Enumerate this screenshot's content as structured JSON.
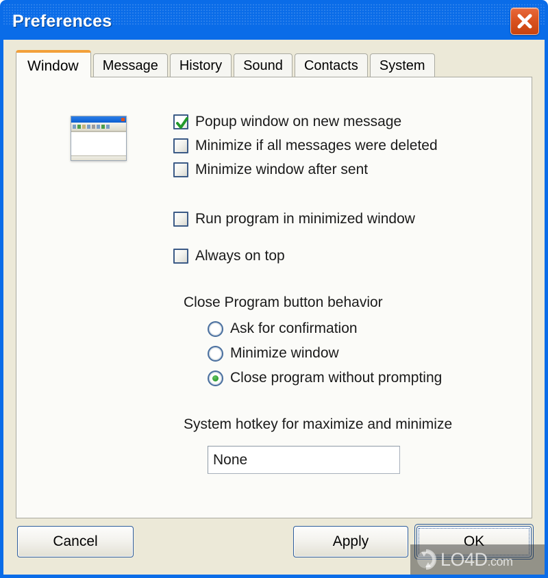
{
  "window": {
    "title": "Preferences",
    "close_icon": "close-x-icon",
    "titlebar_color": "#0a6ce8",
    "client_color": "#ece9d8",
    "close_button_color": "#d9521f"
  },
  "tabs": [
    {
      "label": "Window",
      "active": true
    },
    {
      "label": "Message",
      "active": false
    },
    {
      "label": "History",
      "active": false
    },
    {
      "label": "Sound",
      "active": false
    },
    {
      "label": "Contacts",
      "active": false
    },
    {
      "label": "System",
      "active": false
    }
  ],
  "active_tab_accent": "#f2a03a",
  "preview": {
    "icon": "window-preview-thumbnail"
  },
  "checkboxes": [
    {
      "label": "Popup window on new message",
      "checked": true
    },
    {
      "label": "Minimize if all messages were deleted",
      "checked": false
    },
    {
      "label": "Minimize window after sent",
      "checked": false
    },
    {
      "label": "Run program in minimized window",
      "checked": false
    },
    {
      "label": "Always on top",
      "checked": false
    }
  ],
  "close_behavior": {
    "group_label": "Close Program button behavior",
    "options": [
      {
        "label": "Ask for confirmation",
        "selected": false
      },
      {
        "label": "Minimize window",
        "selected": false
      },
      {
        "label": "Close program without prompting",
        "selected": true
      }
    ],
    "selected_color": "#2f9c2f"
  },
  "hotkey": {
    "label": "System hotkey for maximize and minimize",
    "value": "None",
    "placeholder": "None"
  },
  "footer": {
    "cancel_label": "Cancel",
    "apply_label": "Apply",
    "ok_label": "OK"
  },
  "watermark": {
    "text": "LO4D",
    "suffix": ".com",
    "icon": "refresh-arrows-icon"
  }
}
